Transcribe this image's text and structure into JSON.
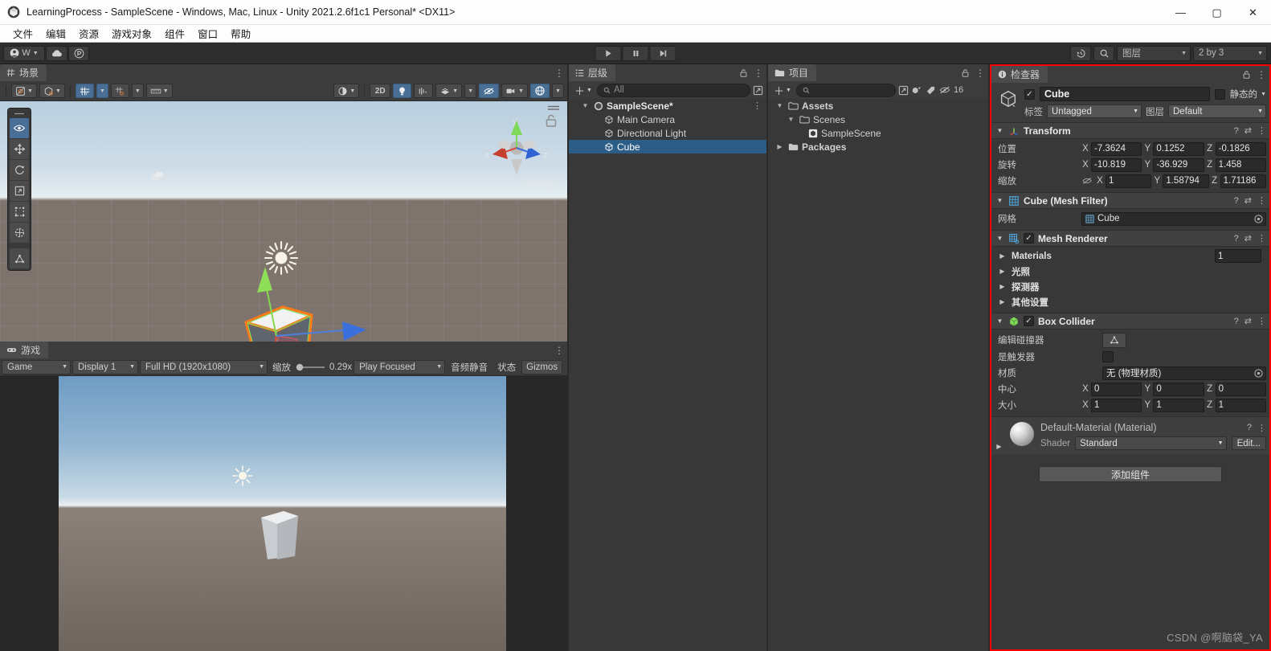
{
  "window": {
    "title": "LearningProcess - SampleScene - Windows, Mac, Linux - Unity 2021.2.6f1c1 Personal* <DX11>",
    "minimize": "—",
    "maximize": "▢",
    "close": "✕"
  },
  "menubar": {
    "items": [
      {
        "label": "文件"
      },
      {
        "label": "编辑"
      },
      {
        "label": "资源"
      },
      {
        "label": "游戏对象"
      },
      {
        "label": "组件"
      },
      {
        "label": "窗口"
      },
      {
        "label": "帮助"
      }
    ]
  },
  "toolbar": {
    "account_label": "W",
    "cloud_icon": "cloud-icon",
    "collab_icon": "collab-icon",
    "play": "▶",
    "pause": "❙❙",
    "step": "▶❙",
    "history_icon": "history-icon",
    "search_icon": "search-icon",
    "layers_label": "图层",
    "layout_label": "2 by 3"
  },
  "scene_panel": {
    "tab_label": "场景",
    "tab_icon": "scene-grid-icon",
    "toolbar": {
      "draw_mode_icon": "shading-mode-icon",
      "gizmo_mode_icon": "gizmo-cube-icon",
      "grid_icon": "grid-axis-icon",
      "snap_icon": "snap-increment-icon",
      "ruler_icon": "ruler-icon",
      "shading_icon": "shaded-sphere-icon",
      "mode_2d": "2D",
      "light_icon": "lighting-bulb-icon",
      "audio_icon": "audio-mute-icon",
      "fx_icon": "effects-icon",
      "visibility_icon": "scene-visibility-icon",
      "camera_icon": "scene-camera-icon",
      "gizmos_icon": "gizmos-globe-icon"
    },
    "tools": [
      {
        "name": "view-tool",
        "icon": "eye-icon",
        "active": true
      },
      {
        "name": "move-tool",
        "icon": "move-arrows-icon",
        "active": false
      },
      {
        "name": "rotate-tool",
        "icon": "rotate-icon",
        "active": false
      },
      {
        "name": "scale-tool",
        "icon": "scale-icon",
        "active": false
      },
      {
        "name": "rect-tool",
        "icon": "rect-transform-icon",
        "active": false
      },
      {
        "name": "transform-tool",
        "icon": "transform-globe-icon",
        "active": false
      },
      {
        "name": "custom-editor-tool",
        "icon": "collider-edit-icon",
        "active": false
      }
    ],
    "gizmo": {
      "x_label": "x",
      "y_label": "y",
      "z_label": "z",
      "persp_label": "＜Persp"
    }
  },
  "game_panel": {
    "tab_label": "游戏",
    "tab_icon": "gamepad-icon",
    "toolbar": {
      "target": "Game",
      "display": "Display 1",
      "resolution": "Full HD (1920x1080)",
      "scale_label": "缩放",
      "scale_value": "0.29x",
      "play_mode": "Play Focused",
      "mute_audio": "音频静音",
      "stats": "状态",
      "gizmos": "Gizmos"
    }
  },
  "hierarchy_panel": {
    "tab_label": "层级",
    "tab_icon": "hierarchy-icon",
    "add_label": "＋",
    "search_placeholder": "All",
    "tree": [
      {
        "label": "SampleScene*",
        "icon": "unity-scene-icon",
        "depth": 0,
        "expanded": true,
        "selected": false
      },
      {
        "label": "Main Camera",
        "icon": "gameobject-icon",
        "depth": 1,
        "expanded": false,
        "selected": false
      },
      {
        "label": "Directional Light",
        "icon": "gameobject-icon",
        "depth": 1,
        "expanded": false,
        "selected": false
      },
      {
        "label": "Cube",
        "icon": "gameobject-icon",
        "depth": 1,
        "expanded": false,
        "selected": true
      }
    ]
  },
  "project_panel": {
    "tab_label": "项目",
    "tab_icon": "folder-icon",
    "add_label": "＋",
    "search_placeholder": "",
    "icon_count": "16",
    "tree": [
      {
        "label": "Assets",
        "icon": "folder-open-icon",
        "depth": 0,
        "expanded": true,
        "bold": true
      },
      {
        "label": "Scenes",
        "icon": "folder-open-icon",
        "depth": 1,
        "expanded": true,
        "bold": false
      },
      {
        "label": "SampleScene",
        "icon": "unity-scene-icon",
        "depth": 2,
        "expanded": null,
        "bold": false
      },
      {
        "label": "Packages",
        "icon": "folder-icon",
        "depth": 0,
        "expanded": false,
        "bold": true
      }
    ]
  },
  "inspector": {
    "tab_label": "检查器",
    "tab_icon": "info-icon",
    "lock_icon": "lock-icon",
    "menu_icon": "kebab-menu-icon",
    "object_name": "Cube",
    "enabled": true,
    "static_label": "静态的",
    "tag_label": "标签",
    "tag_value": "Untagged",
    "layer_label": "图层",
    "layer_value": "Default",
    "transform": {
      "title": "Transform",
      "rows": [
        {
          "label": "位置",
          "x": "-7.3624",
          "y": "0.1252",
          "z": "-0.1826",
          "link": false
        },
        {
          "label": "旋转",
          "x": "-10.819",
          "y": "-36.929",
          "z": "1.458",
          "link": false
        },
        {
          "label": "缩放",
          "x": "1",
          "y": "1.58794",
          "z": "1.71186",
          "link": true
        }
      ],
      "axis_x": "X",
      "axis_y": "Y",
      "axis_z": "Z"
    },
    "mesh_filter": {
      "title": "Cube (Mesh Filter)",
      "mesh_label": "网格",
      "mesh_value": "Cube"
    },
    "mesh_renderer": {
      "title": "Mesh Renderer",
      "enabled": true,
      "materials_label": "Materials",
      "materials_count": "1",
      "foldouts": [
        "光照",
        "探测器",
        "其他设置"
      ]
    },
    "box_collider": {
      "title": "Box Collider",
      "enabled": true,
      "edit_collider_label": "编辑碰撞器",
      "edit_collider_icon": "collider-edit-icon",
      "is_trigger_label": "是触发器",
      "is_trigger": false,
      "material_label": "材质",
      "material_value": "无 (物理材质)",
      "center_label": "中心",
      "center": {
        "x": "0",
        "y": "0",
        "z": "0"
      },
      "size_label": "大小",
      "size": {
        "x": "1",
        "y": "1",
        "z": "1"
      }
    },
    "material_block": {
      "title": "Default-Material (Material)",
      "shader_label": "Shader",
      "shader_value": "Standard",
      "edit_label": "Edit..."
    },
    "add_component_label": "添加组件"
  },
  "watermark": "CSDN @啊脑袋_YA",
  "colors": {
    "accent_red": "#ff0000",
    "selection_blue": "#2c5d87",
    "toolbar_bg": "#2d2d2d",
    "panel_bg": "#383838"
  }
}
